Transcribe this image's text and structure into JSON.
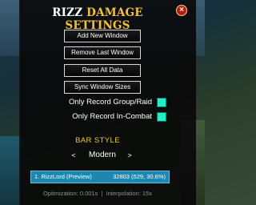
{
  "window": {
    "title_lead": "RIZZ",
    "title_rest": "DAMAGE SETTINGS",
    "close_icon": "close-icon"
  },
  "buttons": {
    "add_new_window": "Add New Window",
    "remove_last_window": "Remove Last Window",
    "reset_all_data": "Reset All Data",
    "sync_window_sizes": "Sync Window Sizes"
  },
  "checkboxes": [
    {
      "label": "Only Record Group/Raid",
      "checked": true
    },
    {
      "label": "Only Record In-Combat",
      "checked": true
    }
  ],
  "bar_style": {
    "label": "BAR STYLE",
    "prev": "<",
    "value": "Modern",
    "next": ">"
  },
  "preview": {
    "name": "1. RizzLord (Preview)",
    "value": "32803 (529, 30.6%)"
  },
  "footer": {
    "optimization": "Optimization: 0.001s",
    "separator": "|",
    "interpolation": "Interpolation: 15x"
  },
  "colors": {
    "title_gold": "#f4c430",
    "checkbox_teal": "#1ff0c8",
    "preview_bar": "#1c88b0",
    "close_red": "#b51c10"
  }
}
